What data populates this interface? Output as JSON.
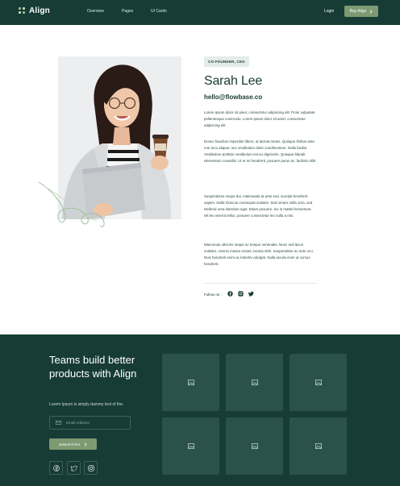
{
  "nav": {
    "brand": "Align",
    "links": [
      "Overview",
      "Pages",
      "UI Cards"
    ],
    "login": "Login",
    "buy": "Buy Align",
    "buy_icon": "chevron-right-icon"
  },
  "profile": {
    "role": "CO-FOUNDER, CEO",
    "name": "Sarah Lee",
    "email": "hello@flowbase.co",
    "paragraphs": [
      "Lorem ipsum dolor sit amet, consectetur adipiscing elit. Proin vulputate pellentesque commodo. Lorem ipsum dolor sit amet, consectetur adipiscing elit.",
      "Donec faucibus imperdiet libero, at lacinia metus. Quisque finibus ante non arcu aliquet, nec vestibulum dolor condimentum. Nulla facilisi. Vestibulum porttitor vestibulum est eu dignissim. Quisque blandit elementum convallis. Ut et mi hendrerit, posuere purus ac, facilisis nibh.",
      "Suspendisse neque dui, malesuada at ante sed, suscipit hendrerit sapien. Nulla rhoncus consequat sodales. Sed ornare nulla urna, sed eleifend urna interdum eget. Etiam posuere, leo in mattis fermentum, elit leo viverra tellus, posuere consectetur leo nulla a nisi.",
      "Maecenas ultricies neque ac tempor venenatis. Nunc sed lacus sodales, viverra massa ornare, lacinia nibh. Suspendisse ac ante orci. Duis hendrerit enim ac lobortis volutpat. Nulla iaculis enim ut cursus hendrerit."
    ],
    "follow_label": "Follow on :",
    "socials": [
      "facebook-icon",
      "instagram-icon",
      "twitter-icon"
    ]
  },
  "cta": {
    "title": "Teams build better products with Align",
    "subtitle": "Lorem Ipsum is simply dummy text of the.",
    "email_placeholder": "Email Address",
    "submit": "Submit Form",
    "socials": [
      "facebook-icon",
      "twitter-icon",
      "instagram-icon"
    ],
    "tiles": [
      "image-icon",
      "image-icon",
      "image-icon",
      "image-icon",
      "image-icon",
      "image-icon"
    ]
  },
  "colors": {
    "dark": "#173c36",
    "accent": "#7d9a72",
    "tile": "#2a524b"
  }
}
